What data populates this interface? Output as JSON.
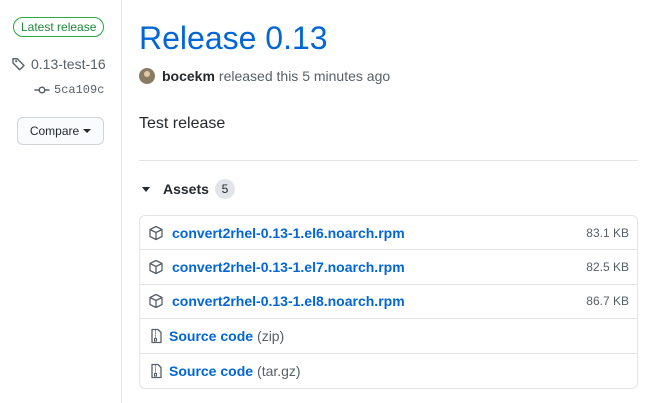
{
  "sidebar": {
    "latest_badge": "Latest release",
    "tag": "0.13-test-16",
    "commit": "5ca109c",
    "compare_label": "Compare"
  },
  "release": {
    "title": "Release 0.13",
    "author": "bocekm",
    "released_text": "released this 5 minutes ago",
    "body": "Test release"
  },
  "assets": {
    "label": "Assets",
    "count": "5",
    "files": [
      {
        "name": "convert2rhel-0.13-1.el6.noarch.rpm",
        "size": "83.1 KB"
      },
      {
        "name": "convert2rhel-0.13-1.el7.noarch.rpm",
        "size": "82.5 KB"
      },
      {
        "name": "convert2rhel-0.13-1.el8.noarch.rpm",
        "size": "86.7 KB"
      }
    ],
    "source": [
      {
        "label": "Source code",
        "format": "(zip)"
      },
      {
        "label": "Source code",
        "format": "(tar.gz)"
      }
    ]
  },
  "colors": {
    "link": "#0366d6",
    "badge_green": "#28a745",
    "muted": "#586069",
    "border": "#e1e4e8"
  },
  "icons": {
    "tag": "tag-icon",
    "commit": "git-commit-icon",
    "package": "package-icon",
    "archive": "file-zip-icon"
  }
}
